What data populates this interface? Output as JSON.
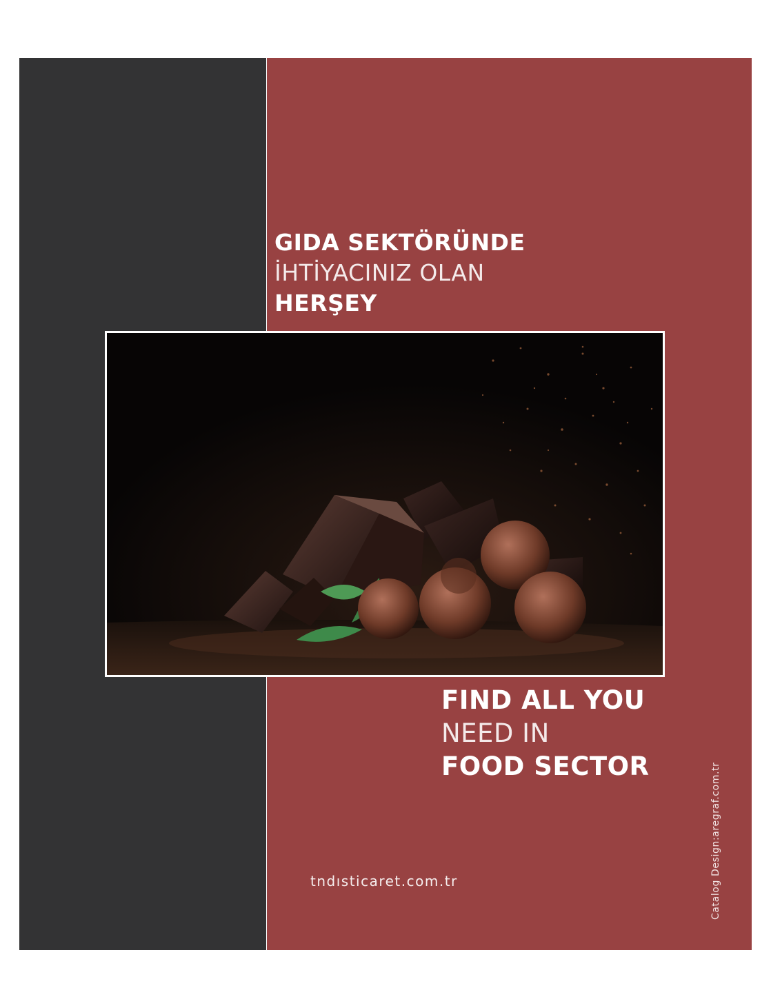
{
  "headline_tr": {
    "line1": "GIDA SEKTÖRÜNDE",
    "line2": "İHTİYACINIZ OLAN",
    "line3": "HERŞEY"
  },
  "headline_en": {
    "line1": "FIND ALL YOU",
    "line2": "NEED IN",
    "line3": "FOOD SECTOR"
  },
  "website": "tndısticaret.com.tr",
  "credit": "Catalog Design:aregraf.com.tr",
  "colors": {
    "dark_panel": "#333334",
    "red_panel": "#984242",
    "text": "#ffffff"
  },
  "photo": {
    "subject": "chocolate-truffles-photo"
  }
}
